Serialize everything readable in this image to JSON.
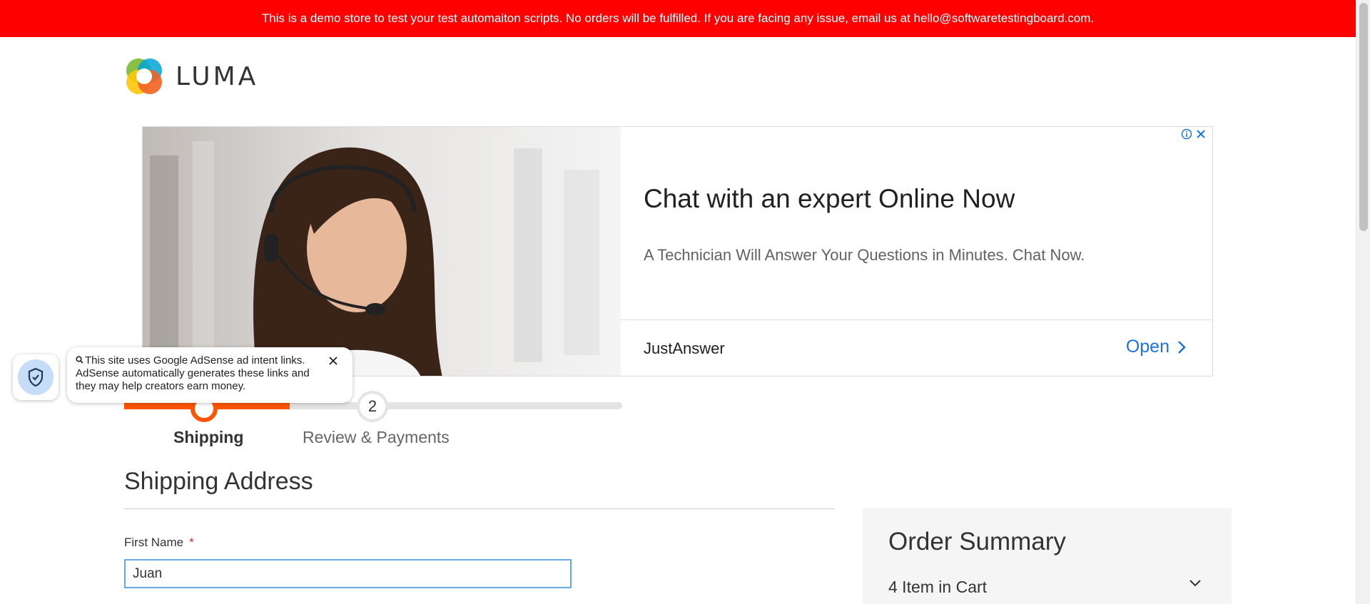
{
  "banner": {
    "text": "This is a demo store to test your test automaiton scripts. No orders will be fulfilled. If you are facing any issue, email us at hello@softwaretestingboard.com."
  },
  "logo": {
    "text": "LUMA",
    "colors": [
      "#f26322",
      "#7ab833",
      "#ffc80a",
      "#00a4d4"
    ]
  },
  "ad": {
    "headline": "Chat with an expert Online Now",
    "description": "A Technician Will Answer Your Questions in Minutes. Chat Now.",
    "advertiser": "JustAnswer",
    "open_label": "Open",
    "accent": "#1a73e8"
  },
  "adsense_notice": {
    "text": "This site uses Google AdSense ad intent links. AdSense automatically generates these links and they may help creators earn money."
  },
  "progress": {
    "step1_label": "Shipping",
    "step2_number": "2",
    "step2_label": "Review & Payments",
    "accent": "#ff5501"
  },
  "shipping": {
    "title": "Shipping Address",
    "first_name_label": "First Name",
    "required_mark": "*",
    "first_name_value": "Juan"
  },
  "summary": {
    "title": "Order Summary",
    "items_label": "4 Item in Cart"
  }
}
